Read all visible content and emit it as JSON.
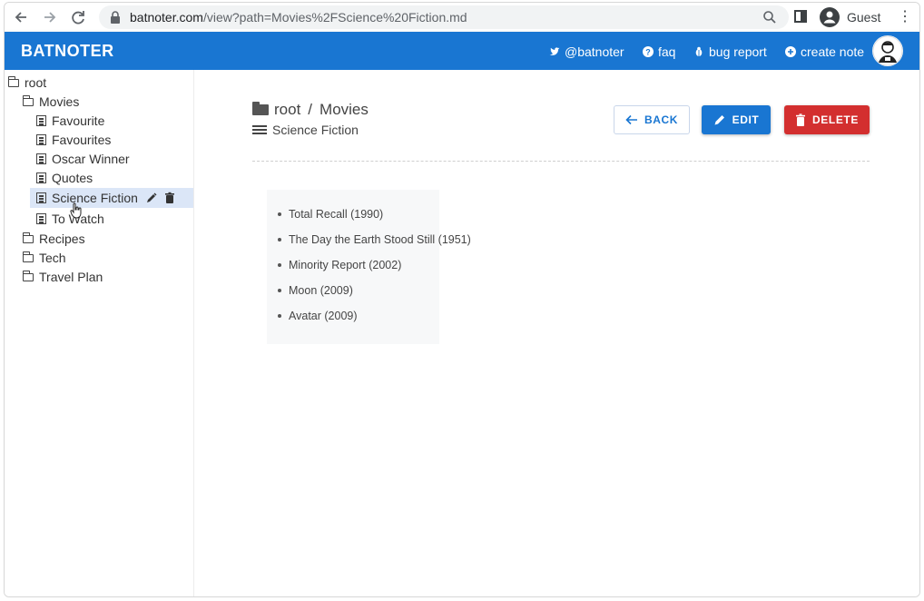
{
  "browser": {
    "url_host": "batnoter.com",
    "url_path": "/view?path=Movies%2FScience%20Fiction.md",
    "profile_label": "Guest"
  },
  "header": {
    "brand": "BATNOTER",
    "links": [
      {
        "icon": "twitter-icon",
        "label": "@batnoter"
      },
      {
        "icon": "help-circle-icon",
        "label": "faq"
      },
      {
        "icon": "bug-icon",
        "label": "bug report"
      },
      {
        "icon": "plus-circle-icon",
        "label": "create note"
      }
    ]
  },
  "sidebar": {
    "root": "root",
    "folders": [
      "Movies",
      "Recipes",
      "Tech",
      "Travel Plan"
    ],
    "movies_notes": [
      "Favourite",
      "Favourites",
      "Oscar Winner",
      "Quotes",
      "Science Fiction",
      "To Watch"
    ],
    "active_note": "Science Fiction"
  },
  "main": {
    "breadcrumb_root": "root",
    "breadcrumb_sep": "/",
    "breadcrumb_folder": "Movies",
    "note_title": "Science Fiction",
    "buttons": {
      "back": "BACK",
      "edit": "EDIT",
      "delete": "DELETE"
    },
    "items": [
      "Total Recall (1990)",
      "The Day the Earth Stood Still (1951)",
      "Minority Report (2002)",
      "Moon (2009)",
      "Avatar (2009)"
    ]
  },
  "colors": {
    "primary": "#1976d2",
    "danger": "#d32f2f",
    "active_bg": "#dbe6f7"
  }
}
